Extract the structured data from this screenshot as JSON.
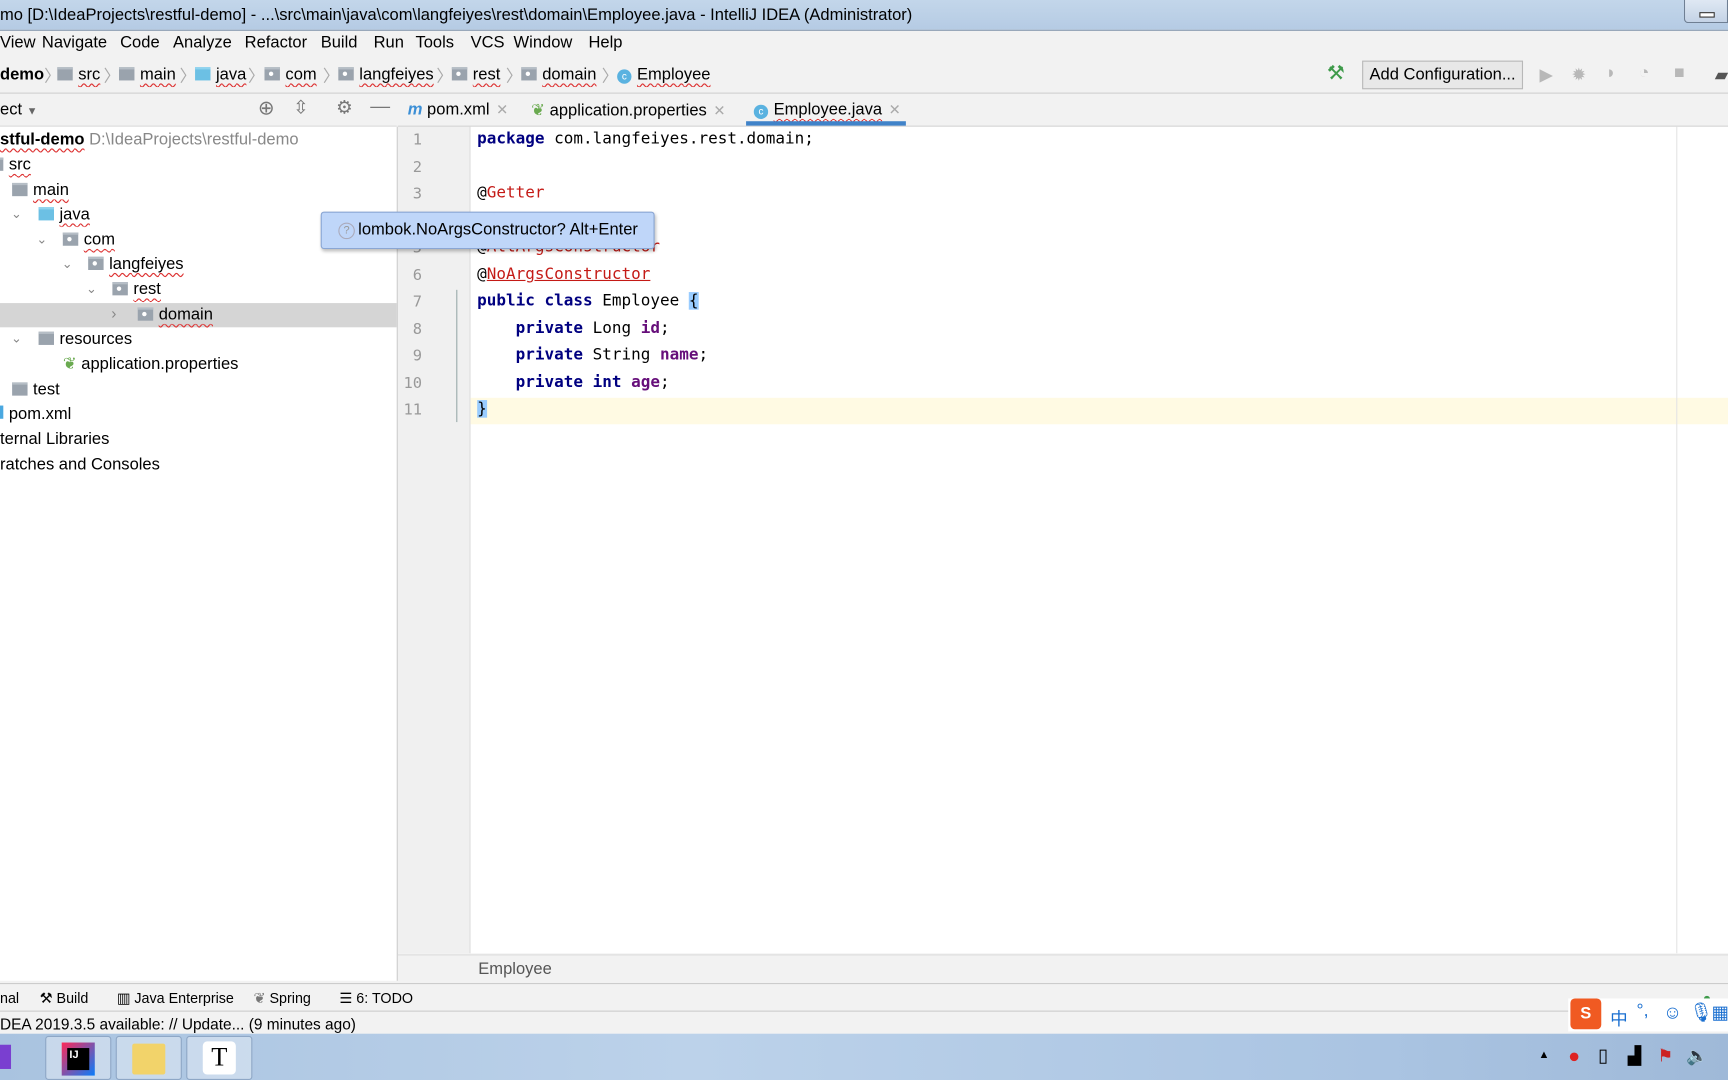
{
  "window": {
    "title": "mo [D:\\IdeaProjects\\restful-demo] - ...\\src\\main\\java\\com\\langfeiyes\\rest\\domain\\Employee.java - IntelliJ IDEA (Administrator)"
  },
  "menu": [
    {
      "label": "View",
      "u": "V"
    },
    {
      "label": "Navigate"
    },
    {
      "label": "Code"
    },
    {
      "label": "Analyze"
    },
    {
      "label": "Refactor"
    },
    {
      "label": "Build"
    },
    {
      "label": "Run"
    },
    {
      "label": "Tools"
    },
    {
      "label": "VCS"
    },
    {
      "label": "Window"
    },
    {
      "label": "Help"
    }
  ],
  "breadcrumb": [
    "demo",
    "src",
    "main",
    "java",
    "com",
    "langfeiyes",
    "rest",
    "domain",
    "Employee"
  ],
  "toolbar": {
    "add_configuration": "Add Configuration...",
    "hammer_color": "#3e9a4a"
  },
  "project": {
    "header": "ect",
    "root_name": "stful-demo",
    "root_path": "D:\\IdeaProjects\\restful-demo",
    "items": [
      "src",
      "main",
      "java",
      "com",
      "langfeiyes",
      "rest",
      "domain",
      "resources",
      "application.properties",
      "test",
      "pom.xml",
      "ternal Libraries",
      "ratches and Consoles"
    ]
  },
  "tabs": [
    {
      "label": "pom.xml",
      "icon": "maven-icon"
    },
    {
      "label": "application.properties",
      "icon": "spring-icon"
    },
    {
      "label": "Employee.java",
      "icon": "class-icon",
      "active": true
    }
  ],
  "editor": {
    "lines": [
      "1",
      "2",
      "3",
      "5",
      "6",
      "7",
      "8",
      "9",
      "10",
      "11"
    ],
    "code": {
      "l1_kw": "package",
      "l1_rest": " com.langfeiyes.rest.domain;",
      "l3": "Getter",
      "l5": "AllArgsConstructor",
      "l6": "NoArgsConstructor",
      "l7_kw": "public class",
      "l7_name": " Employee ",
      "brace_open": "{",
      "private": "private",
      "l8_type": " Long ",
      "l8_f": "id",
      "l9_type": " String ",
      "l9_f": "name",
      "int": " int ",
      "l10_f": "age",
      "semi": ";",
      "at": "@",
      "brace_close": "}"
    },
    "tooltip": "lombok.NoArgsConstructor? Alt+Enter",
    "breadcrumb": "Employee"
  },
  "toolwindows": [
    "nal",
    "Build",
    "Java Enterprise",
    "Spring",
    "6: TODO"
  ],
  "status": "DEA 2019.3.5 available: // Update... (9 minutes ago)",
  "taskbar": {
    "apps": [
      "intellij-icon",
      "explorer-icon",
      "typora-icon"
    ],
    "t_label": "T",
    "ime": "中"
  }
}
